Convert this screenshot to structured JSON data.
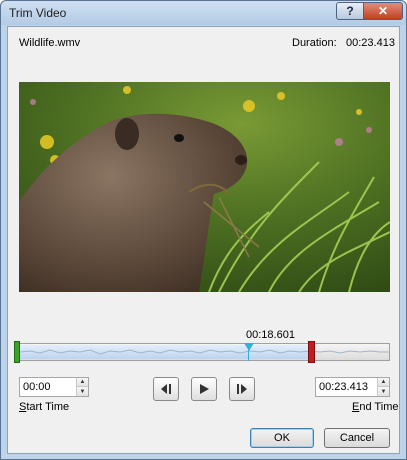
{
  "window": {
    "title": "Trim Video",
    "help_label": "?",
    "close_label": "✕"
  },
  "file": {
    "name": "Wildlife.wmv",
    "duration_label": "Duration:",
    "duration_value": "00:23.413"
  },
  "timeline": {
    "current_time": "00:18.601",
    "selected_start_fraction": 0.0,
    "selected_end_fraction": 1.0,
    "playhead_fraction": 0.794
  },
  "start_time": {
    "value": "00:00",
    "label": "Start Time",
    "label_underline_char": "S"
  },
  "end_time": {
    "value": "00:23.413",
    "label": "End Time",
    "label_underline_char": "E"
  },
  "controls": {
    "prev_frame_icon": "previous-frame-icon",
    "play_icon": "play-icon",
    "next_frame_icon": "next-frame-icon"
  },
  "buttons": {
    "ok": "OK",
    "cancel": "Cancel"
  },
  "colors": {
    "start_marker": "#3aa12b",
    "end_marker": "#c21e1e",
    "playhead": "#2fb1d8",
    "title_bg": "#bcd3ea"
  }
}
